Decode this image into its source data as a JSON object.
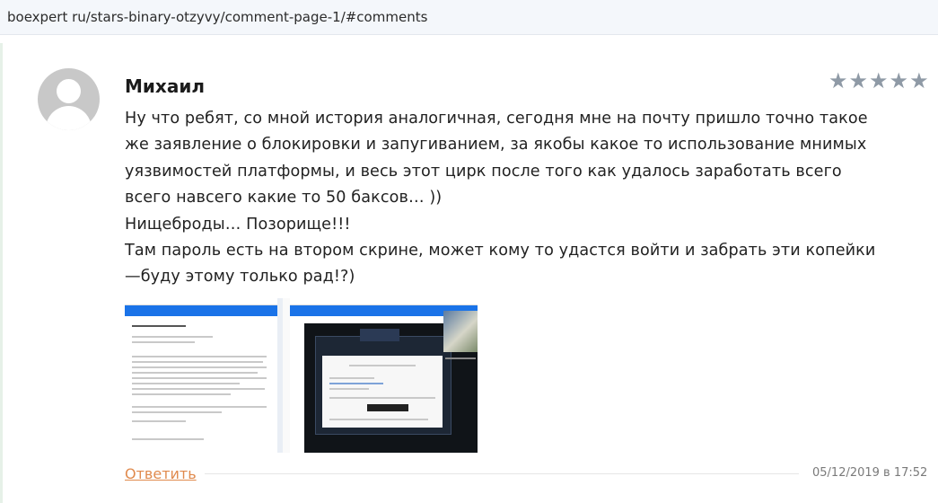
{
  "address_bar": {
    "url": "boexpert ru/stars-binary-otzyvy/comment-page-1/#comments"
  },
  "comment": {
    "author": "Михаил",
    "rating": {
      "value": 5,
      "max": 5,
      "star_glyph": "★",
      "color": "#8f9aa6"
    },
    "text_lines": [
      "Ну что ребят, со мной история аналогичная, сегодня мне на почту пришло точно такое",
      "же заявление о блокировки и запугиванием, за якобы какое то использование мнимых",
      "уязвимостей платформы, и весь этот цирк после того как удалось заработать всего",
      "всего навсего какие то 50 баксов… ))",
      "Нищеброды… Позорище!!!",
      "Там пароль есть на втором скрине, может кому то удастся войти и забрать эти копейки",
      "—буду этому только рад!?)"
    ],
    "attachment": {
      "type": "screenshot-thumbnail",
      "icon": "image-attachment"
    },
    "reply_label": "Ответить",
    "timestamp": "05/12/2019 в 17:52"
  },
  "colors": {
    "reply_link": "#e08a4d",
    "avatar": "#c8c8c8",
    "accent_blue": "#1a73e8"
  }
}
